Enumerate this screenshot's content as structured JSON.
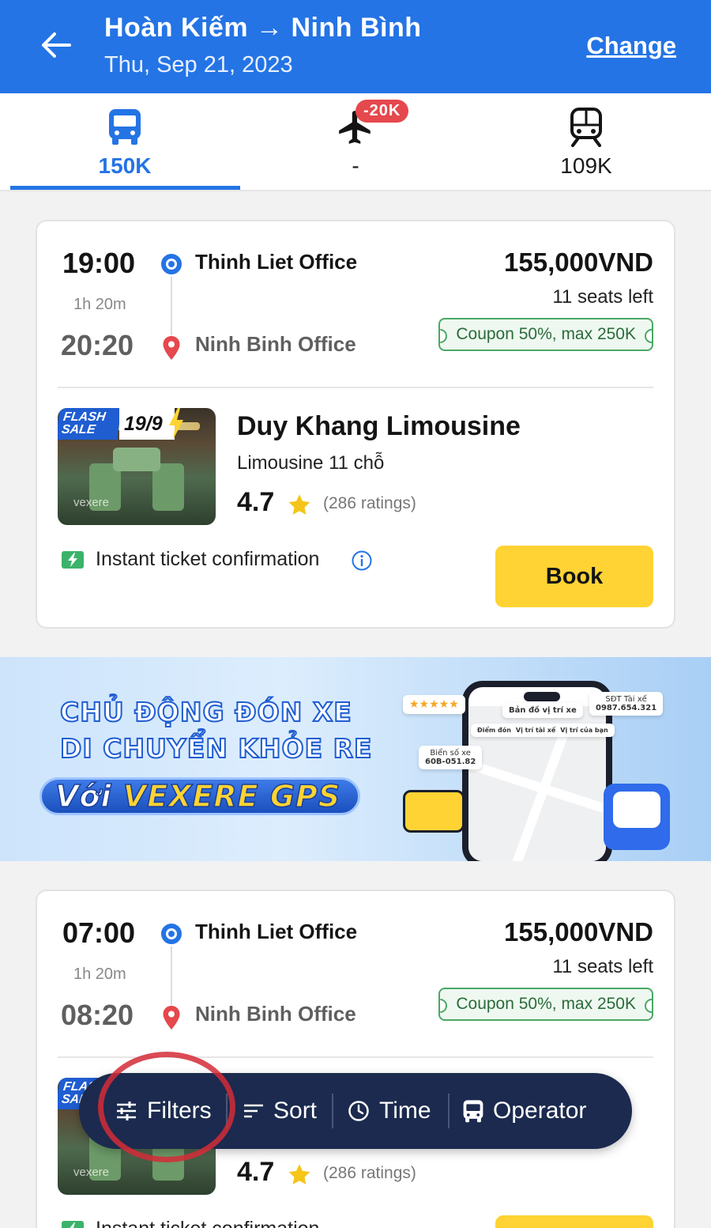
{
  "header": {
    "route": "Hoàn Kiếm → Ninh Bình",
    "date": "Thu, Sep 21, 2023",
    "change_label": "Change"
  },
  "tabs": [
    {
      "icon": "bus-icon",
      "price": "150K",
      "active": true
    },
    {
      "icon": "airplane-icon",
      "price": "-",
      "badge": "-20K",
      "active": false
    },
    {
      "icon": "train-icon",
      "price": "109K",
      "active": false
    }
  ],
  "trips": [
    {
      "departure_time": "19:00",
      "duration": "1h 20m",
      "arrival_time": "20:20",
      "from_office": "Thinh Liet Office",
      "to_office": "Ninh Binh Office",
      "price": "155,000VND",
      "seats": "11 seats left",
      "coupon": "Coupon 50%, max 250K",
      "flash_label": "FLASH SALE",
      "flash_date": "19/9",
      "watermark": "vexere",
      "operator": "Duy Khang Limousine",
      "vehicle_type": "Limousine 11 chỗ",
      "rating": "4.7",
      "rating_count": "(286 ratings)",
      "instant_text": "Instant ticket confirmation",
      "book_label": "Book"
    },
    {
      "departure_time": "07:00",
      "duration": "1h 20m",
      "arrival_time": "08:20",
      "from_office": "Thinh Liet Office",
      "to_office": "Ninh Binh Office",
      "price": "155,000VND",
      "seats": "11 seats left",
      "coupon": "Coupon 50%, max 250K",
      "flash_label": "FLASH SALE",
      "watermark": "vexere",
      "rating": "4.7",
      "rating_count": "(286 ratings)",
      "instant_text": "Instant ticket confirmation"
    }
  ],
  "banner": {
    "line1": "CHỦ ĐỘNG ĐÓN XE",
    "line2": "DI CHUYỂN KHỎE RE",
    "pill_prefix": "Với",
    "pill_brand": "VEXERE GPS",
    "map_label": "Bản đồ vị trí xe",
    "pickup_label": "Điểm đón",
    "driver_pos_label": "Vị trí tài xế",
    "your_pos_label": "Vị trí của bạn",
    "driver_phone_label": "SĐT Tài xế",
    "driver_phone": "0987.654.321",
    "plate_label": "Biển số xe",
    "plate": "60B-051.82"
  },
  "filter_bar": {
    "filters": "Filters",
    "sort": "Sort",
    "time": "Time",
    "operator": "Operator"
  },
  "colors": {
    "brand_blue": "#2474e5",
    "book_yellow": "#ffd333",
    "filter_bar": "#1b2a4e",
    "coupon_green": "#4aa865"
  }
}
